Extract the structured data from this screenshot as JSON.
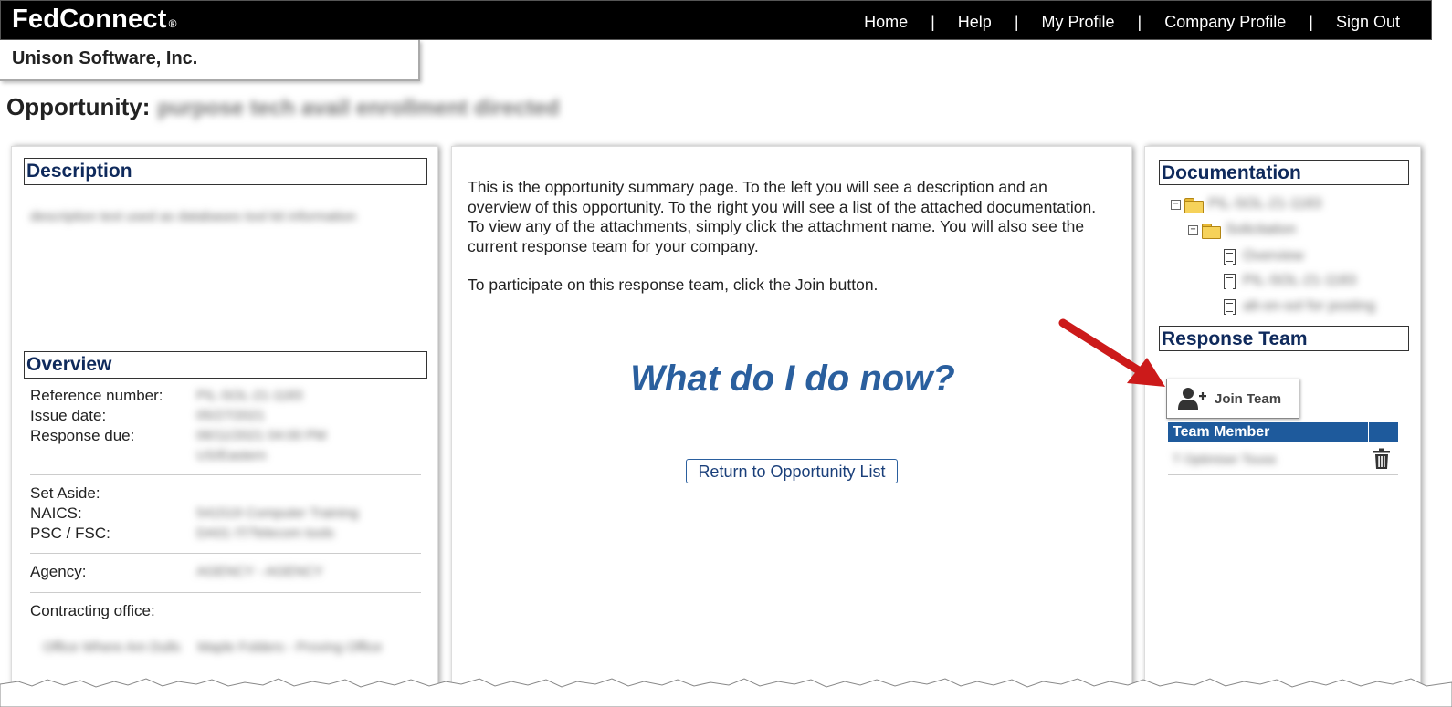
{
  "brand": {
    "name": "FedConnect",
    "reg": "®"
  },
  "nav": {
    "items": [
      "Home",
      "Help",
      "My Profile",
      "Company Profile",
      "Sign Out"
    ],
    "separator": "|"
  },
  "company": {
    "name": "Unison Software, Inc."
  },
  "opportunity": {
    "label": "Opportunity:",
    "name_blurred": "purpose tech avail enrollment directed"
  },
  "left_panel": {
    "description_title": "Description",
    "description_blurred": "description text used as databases tool kit information",
    "overview_title": "Overview",
    "groups": [
      {
        "rows": [
          {
            "label": "Reference number:",
            "value": "PIL-SOL-21-1183"
          },
          {
            "label": "Issue date:",
            "value": "05/27/2021"
          },
          {
            "label": "Response due:",
            "value": "06/11/2021 04:00 PM"
          },
          {
            "label": "",
            "value": "US/Eastern"
          }
        ]
      },
      {
        "rows": [
          {
            "label": "Set Aside:",
            "value": ""
          },
          {
            "label": "NAICS:",
            "value": "541519 Computer Training"
          },
          {
            "label": "PSC / FSC:",
            "value": "DA01 IT/Telecom tools"
          }
        ]
      },
      {
        "rows": [
          {
            "label": "Agency:",
            "value": "AGENCY - AGENCY"
          }
        ]
      },
      {
        "rows": [
          {
            "label": "Contracting office:",
            "value": ""
          }
        ]
      }
    ],
    "contracting_office_blurred": [
      "Office Where Am Dulls",
      "Maple Folders - Proving Office"
    ]
  },
  "middle_panel": {
    "paragraph1": "This is the opportunity summary page. To the left you will see a description and an overview of this opportunity. To the right you will see a list of the attached documentation. To view any of the attachments, simply click the attachment name. You will also see the current response team for your company.",
    "paragraph2": "To participate on this response team, click the Join button.",
    "heading": "What do I do now?",
    "return_button": "Return to Opportunity List"
  },
  "right_panel": {
    "documentation_title": "Documentation",
    "tree": [
      {
        "type": "folder",
        "toggle": "−",
        "level": 0,
        "label": "PIL-SOL-21-1183"
      },
      {
        "type": "folder",
        "toggle": "−",
        "level": 1,
        "label": "Solicitation"
      },
      {
        "type": "file",
        "level": 2,
        "label": "Overview"
      },
      {
        "type": "file",
        "level": 2,
        "label": "PIL-SOL-21-1183"
      },
      {
        "type": "file",
        "level": 2,
        "label": "alt-on-sol for posting"
      }
    ],
    "response_team_title": "Response Team",
    "join_button": "Join Team",
    "team_table": {
      "header": "Team Member",
      "rows": [
        {
          "name": "T Optimiser Tousa"
        }
      ]
    }
  },
  "colors": {
    "topbar": "#000000",
    "section_title": "#0f2a5c",
    "heading": "#2a5f9e",
    "table_header": "#1e5a9c",
    "arrow": "#cc1a1a"
  }
}
